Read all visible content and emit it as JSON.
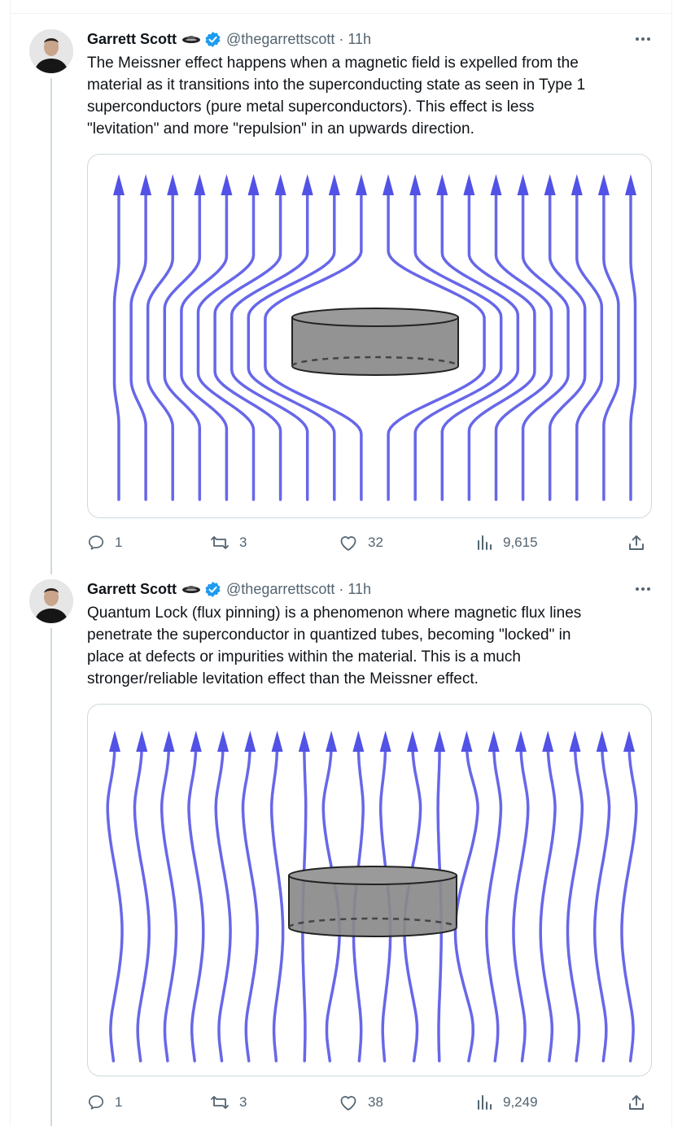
{
  "colors": {
    "verified": "#1d9bf0",
    "field_line": "#5252e6",
    "superconductor": "#8a8a8a",
    "secondary_text": "#536471"
  },
  "tweets": [
    {
      "author": {
        "name": "Garrett Scott",
        "handle": "@thegarrettscott",
        "time": "11h",
        "dot": "·"
      },
      "text_lines": [
        "The Meissner effect happens when a magnetic field is expelled from the",
        "material as it transitions into the superconducting state as seen in Type 1",
        "superconductors (pure metal superconductors). This effect is less",
        "\"levitation\" and more \"repulsion\" in an upwards direction."
      ],
      "media": {
        "kind": "meissner",
        "lines": 20
      },
      "stats": {
        "replies": "1",
        "reposts": "3",
        "likes": "32",
        "views": "9,615"
      }
    },
    {
      "author": {
        "name": "Garrett Scott",
        "handle": "@thegarrettscott",
        "time": "11h",
        "dot": "·"
      },
      "text_lines": [
        "Quantum Lock (flux pinning) is a phenomenon where magnetic flux lines",
        "penetrate the superconductor in quantized tubes, becoming \"locked\" in",
        "place at defects or impurities within the material. This is a much",
        "stronger/reliable levitation effect than the Meissner effect."
      ],
      "media": {
        "kind": "flux_pinning",
        "lines": 20
      },
      "stats": {
        "replies": "1",
        "reposts": "3",
        "likes": "38",
        "views": "9,249"
      }
    }
  ],
  "icons": {
    "reply": "reply-icon",
    "repost": "repost-icon",
    "like": "heart-icon",
    "views": "views-icon",
    "share": "share-icon",
    "more": "more-icon",
    "verified": "verified-badge-icon",
    "saucer": "flying-saucer-icon"
  }
}
